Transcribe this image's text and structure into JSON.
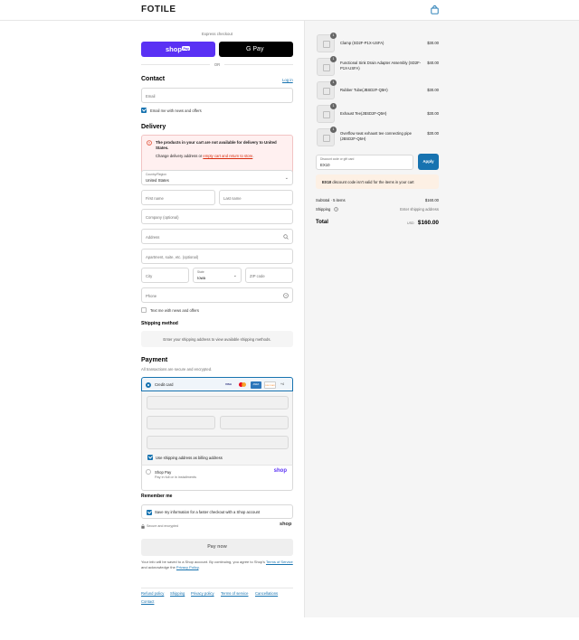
{
  "header": {
    "logo": "FOTILE",
    "cart_icon": "shopping-bag-icon"
  },
  "express": {
    "label": "Express checkout",
    "shop_pay": "shop",
    "shop_pay_badge": "Pay",
    "gpay": "G Pay",
    "or": "OR"
  },
  "contact": {
    "title": "Contact",
    "login": "Log in",
    "email_placeholder": "Email",
    "news_label": "Email me with news and offers",
    "news_checked": true
  },
  "delivery": {
    "title": "Delivery",
    "alert_title": "The products in your cart are not available for delivery to United States.",
    "alert_pre": "Change delivery address or ",
    "alert_link": "empty cart and return to store",
    "alert_post": ".",
    "country_label": "Country/Region",
    "country_value": "United States",
    "first_name": "First name",
    "last_name": "Last name",
    "company": "Company (optional)",
    "address": "Address",
    "apartment": "Apartment, suite, etc. (optional)",
    "city": "City",
    "state_label": "State",
    "state_value": "Iowa",
    "zip": "ZIP code",
    "phone": "Phone",
    "text_label": "Text me with news and offers"
  },
  "shipping_method": {
    "title": "Shipping method",
    "placeholder": "Enter your shipping address to view available shipping methods."
  },
  "payment": {
    "title": "Payment",
    "subtitle": "All transactions are secure and encrypted.",
    "credit_card": "Credit card",
    "cards": [
      "VISA",
      "MC",
      "AMEX",
      "DISCOVER",
      "+4"
    ],
    "billing_label": "Use shipping address as billing address",
    "shop_pay_title": "Shop Pay",
    "shop_pay_sub": "Pay in full or in installments",
    "shop_pay_logo": "shop"
  },
  "remember": {
    "title": "Remember me",
    "save_label": "Save my information for a faster checkout with a Shop account",
    "secure": "Secure and encrypted",
    "shop_logo": "shop"
  },
  "pay_now": "Pay now",
  "legal": {
    "pre": "Your info will be saved to a Shop account. By continuing, you agree to Shop's ",
    "tos": "Terms of Service",
    "mid": " and acknowledge the ",
    "privacy": "Privacy Policy",
    "post": "."
  },
  "footer_links": [
    "Refund policy",
    "Shipping",
    "Privacy policy",
    "Terms of service",
    "Cancellations",
    "Contact"
  ],
  "cart": {
    "items": [
      {
        "qty": "1",
        "name": "Clamp (SD2F-P1X-USFA)",
        "price": "$30.00"
      },
      {
        "qty": "1",
        "name": "Functional Sink Drain Adapter Assembly (SD2F-P1X-USFA)",
        "price": "$40.00"
      },
      {
        "qty": "1",
        "name": "Rubber Tube(JBSD2F-Q5H)",
        "price": "$30.00"
      },
      {
        "qty": "1",
        "name": "Exhaust Tee(JBSD2F-Q5H)",
        "price": "$30.00"
      },
      {
        "qty": "1",
        "name": "Overflow seat exhaust tee connecting pipe (JBSD2F-Q5H)",
        "price": "$30.00"
      }
    ],
    "discount_label": "Discount code or gift card",
    "discount_value": "EX10",
    "apply": "Apply",
    "discount_error_code": "EX10",
    "discount_error_text": " discount code isn't valid for the items in your cart",
    "subtotal_label": "Subtotal · 5 items",
    "subtotal_value": "$160.00",
    "shipping_label": "Shipping",
    "shipping_value": "Enter shipping address",
    "total_label": "Total",
    "total_currency": "USD",
    "total_value": "$160.00"
  }
}
